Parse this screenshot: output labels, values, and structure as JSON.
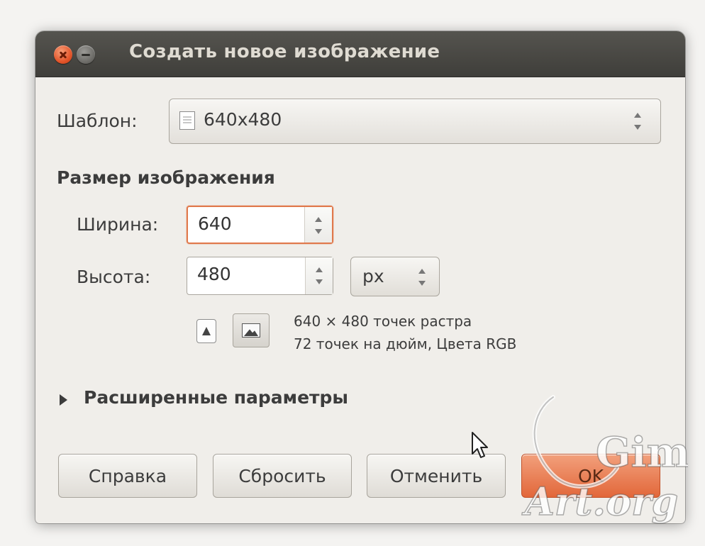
{
  "window": {
    "title": "Создать новое изображение"
  },
  "template": {
    "label": "Шаблон:",
    "value": "640x480"
  },
  "image_size": {
    "heading": "Размер изображения",
    "width_label": "Ширина:",
    "width_value": "640",
    "height_label": "Высота:",
    "height_value": "480",
    "unit": "px"
  },
  "info": {
    "line1": "640 × 480 точек растра",
    "line2": "72 точек на дюйм, Цвета RGB"
  },
  "advanced": {
    "label": "Расширенные параметры"
  },
  "buttons": {
    "help": "Справка",
    "reset": "Сбросить",
    "cancel": "Отменить",
    "ok": "OK"
  },
  "watermark": {
    "line1": "Gimp",
    "line2": "Art.org"
  },
  "colors": {
    "titlebar": "#4a4945",
    "accent": "#e2673a",
    "focus_border": "#e0794c",
    "dialog_bg": "#f0eeea"
  }
}
